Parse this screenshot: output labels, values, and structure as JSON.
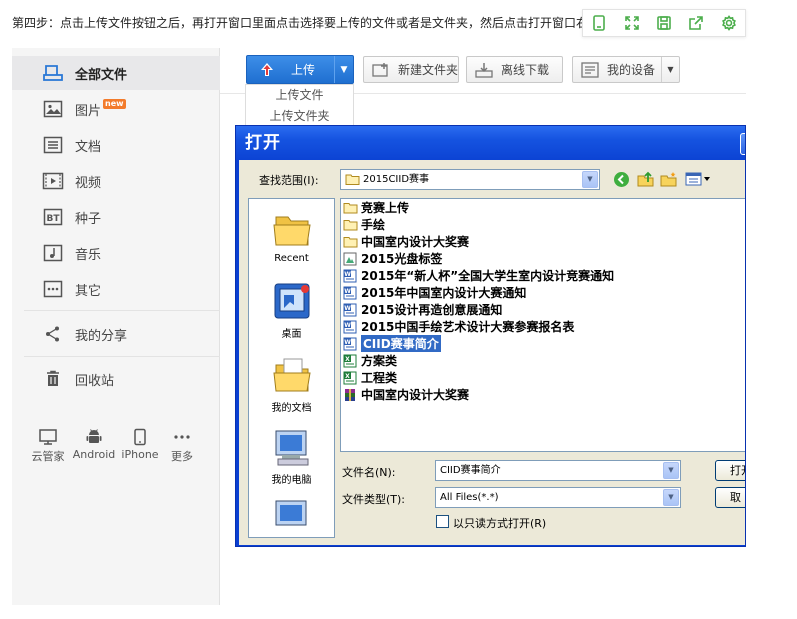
{
  "instruction": "第四步：点击上传文件按钮之后，再打开窗口里面点击选择要上传的文件或者是文件夹，然后点击打开窗口右",
  "toolbar_icons": [
    "phone-icon",
    "expand-icon",
    "save-icon",
    "share-icon",
    "settings-icon"
  ],
  "sidebar": {
    "items": [
      {
        "label": "全部文件",
        "icon": "all-files-icon"
      },
      {
        "label": "图片",
        "icon": "image-icon",
        "badge": "new"
      },
      {
        "label": "文档",
        "icon": "document-icon"
      },
      {
        "label": "视频",
        "icon": "video-icon"
      },
      {
        "label": "种子",
        "icon": "bt-icon"
      },
      {
        "label": "音乐",
        "icon": "music-icon"
      },
      {
        "label": "其它",
        "icon": "more-icon"
      },
      {
        "label": "我的分享",
        "icon": "share-icon"
      },
      {
        "label": "回收站",
        "icon": "trash-icon"
      }
    ],
    "devices": [
      "云管家",
      "Android",
      "iPhone",
      "更多"
    ]
  },
  "actions": {
    "upload": "上传",
    "new_folder": "新建文件夹",
    "offline_download": "离线下载",
    "my_devices": "我的设备"
  },
  "upload_menu": [
    "上传文件",
    "上传文件夹"
  ],
  "dialog": {
    "title": "打开",
    "look_in_label": "查找范围(I):",
    "look_in_value": "2015CIID赛事",
    "places": [
      "Recent",
      "桌面",
      "我的文档",
      "我的电脑"
    ],
    "files": [
      {
        "name": "竞赛上传",
        "type": "folder"
      },
      {
        "name": "手绘",
        "type": "folder"
      },
      {
        "name": "中国室内设计大奖赛",
        "type": "folder"
      },
      {
        "name": "2015光盘标签",
        "type": "image"
      },
      {
        "name": "2015年“新人杯”全国大学生室内设计竞赛通知",
        "type": "doc"
      },
      {
        "name": "2015年中国室内设计大赛通知",
        "type": "doc"
      },
      {
        "name": "2015设计再造创意展通知",
        "type": "doc"
      },
      {
        "name": "2015中国手绘艺术设计大赛参赛报名表",
        "type": "doc"
      },
      {
        "name": "CIID赛事简介",
        "type": "doc",
        "selected": true
      },
      {
        "name": "方案类",
        "type": "excel"
      },
      {
        "name": "工程类",
        "type": "excel"
      },
      {
        "name": "中国室内设计大奖赛",
        "type": "rar"
      }
    ],
    "filename_label": "文件名(N):",
    "filename_value": "CIID赛事简介",
    "filetype_label": "文件类型(T):",
    "filetype_value": "All Files(*.*)",
    "readonly_label": "以只读方式打开(R)",
    "open_button": "打开",
    "cancel_button": "取"
  },
  "colors": {
    "upload_blue": "#2a7de1",
    "dialog_title_blue": "#0c43d4",
    "selection_blue": "#316ac5",
    "tool_green": "#4cae4c"
  }
}
